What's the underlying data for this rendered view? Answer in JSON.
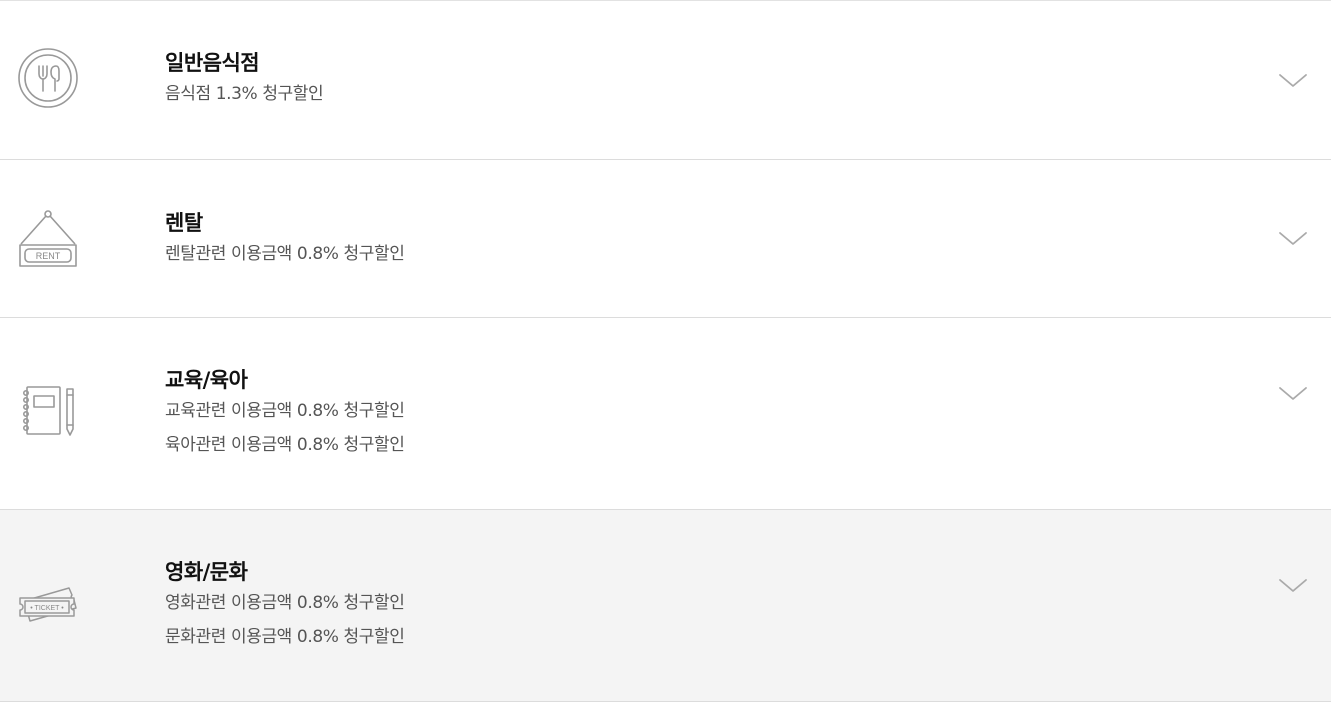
{
  "benefits": [
    {
      "icon": "restaurant-plate-icon",
      "title": "일반음식점",
      "lines": [
        "음식점 1.3% 청구할인"
      ]
    },
    {
      "icon": "rent-sign-icon",
      "icon_text": "RENT",
      "title": "렌탈",
      "lines": [
        "렌탈관련 이용금액 0.8% 청구할인"
      ]
    },
    {
      "icon": "notebook-pencil-icon",
      "title": "교육/육아",
      "lines": [
        "교육관련 이용금액 0.8% 청구할인",
        "육아관련 이용금액 0.8% 청구할인"
      ]
    },
    {
      "icon": "ticket-icon",
      "icon_text": "• TICKET •",
      "title": "영화/문화",
      "lines": [
        "영화관련 이용금액 0.8% 청구할인",
        "문화관련 이용금액 0.8% 청구할인"
      ],
      "highlighted": true
    }
  ],
  "colors": {
    "title": "#111111",
    "description": "#555555",
    "icon_stroke": "#999999",
    "divider": "#dcdcdc",
    "highlight_background": "#f4f4f4"
  }
}
